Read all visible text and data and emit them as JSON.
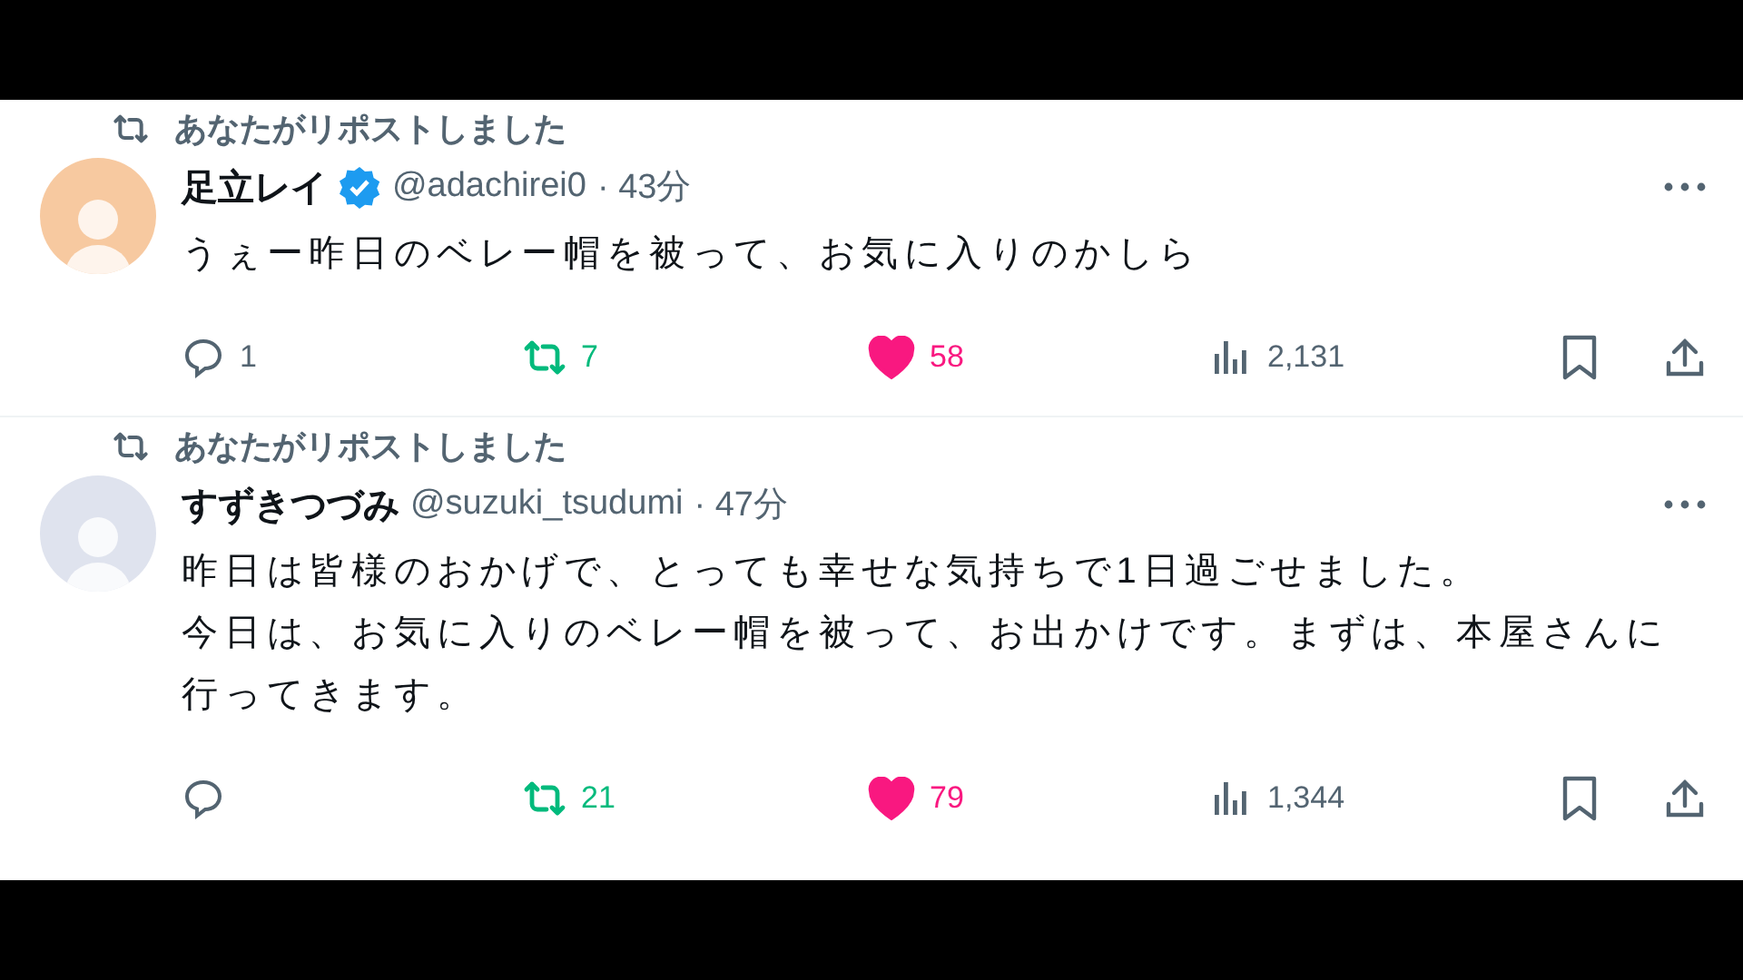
{
  "tweets": [
    {
      "repost_label": "あなたがリポストしました",
      "avatar": {
        "color": "#f7c9a0"
      },
      "name": "足立レイ",
      "verified": true,
      "handle": "@adachirei0",
      "time": "· 43分",
      "body": [
        "うぇー昨日のベレー帽を被って、お気に入りのかしら"
      ],
      "replies": "1",
      "reposts": "7",
      "reposted": true,
      "likes": "58",
      "liked": true,
      "views": "2,131",
      "bookmarked": false
    },
    {
      "repost_label": "あなたがリポストしました",
      "avatar": {
        "color": "#dfe3ee"
      },
      "name": "すずきつづみ",
      "verified": false,
      "handle": "@suzuki_tsudumi",
      "time": "· 47分",
      "body": [
        "昨日は皆様のおかげで、とっても幸せな気持ちで1日過ごせました。",
        "今日は、お気に入りのベレー帽を被って、お出かけです。まずは、本屋さんに行ってきます。"
      ],
      "reposts": "21",
      "reposted": true,
      "likes": "79",
      "liked": true,
      "views": "1,344",
      "bookmarked": false
    }
  ]
}
